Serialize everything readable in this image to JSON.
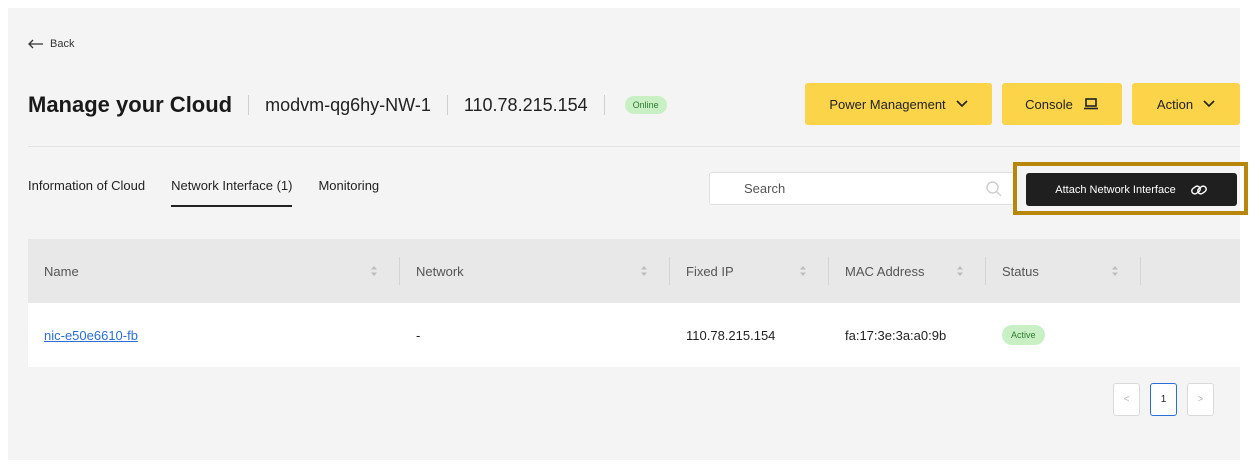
{
  "back": {
    "label": "Back"
  },
  "header": {
    "title": "Manage your Cloud",
    "vm_name": "modvm-qg6hy-NW-1",
    "ip": "110.78.215.154",
    "status": "Online"
  },
  "actions": {
    "power": "Power Management",
    "console": "Console",
    "action": "Action"
  },
  "tabs": [
    {
      "label": "Information of Cloud",
      "active": false
    },
    {
      "label": "Network Interface (1)",
      "active": true
    },
    {
      "label": "Monitoring",
      "active": false
    }
  ],
  "search": {
    "placeholder": "Search",
    "value": ""
  },
  "attach_button": {
    "label": "Attach Network Interface"
  },
  "table": {
    "columns": [
      "Name",
      "Network",
      "Fixed IP",
      "MAC Address",
      "Status"
    ],
    "rows": [
      {
        "name": "nic-e50e6610-fb",
        "network": "-",
        "fixed_ip": "110.78.215.154",
        "mac": "fa:17:3e:3a:a0:9b",
        "status": "Active"
      }
    ]
  },
  "pagination": {
    "prev": "<",
    "current": "1",
    "next": ">"
  },
  "colors": {
    "accent_yellow": "#fbd44a",
    "highlight_border": "#b8860b",
    "status_green_bg": "#c8f0c4",
    "link_blue": "#2b6fd6"
  }
}
